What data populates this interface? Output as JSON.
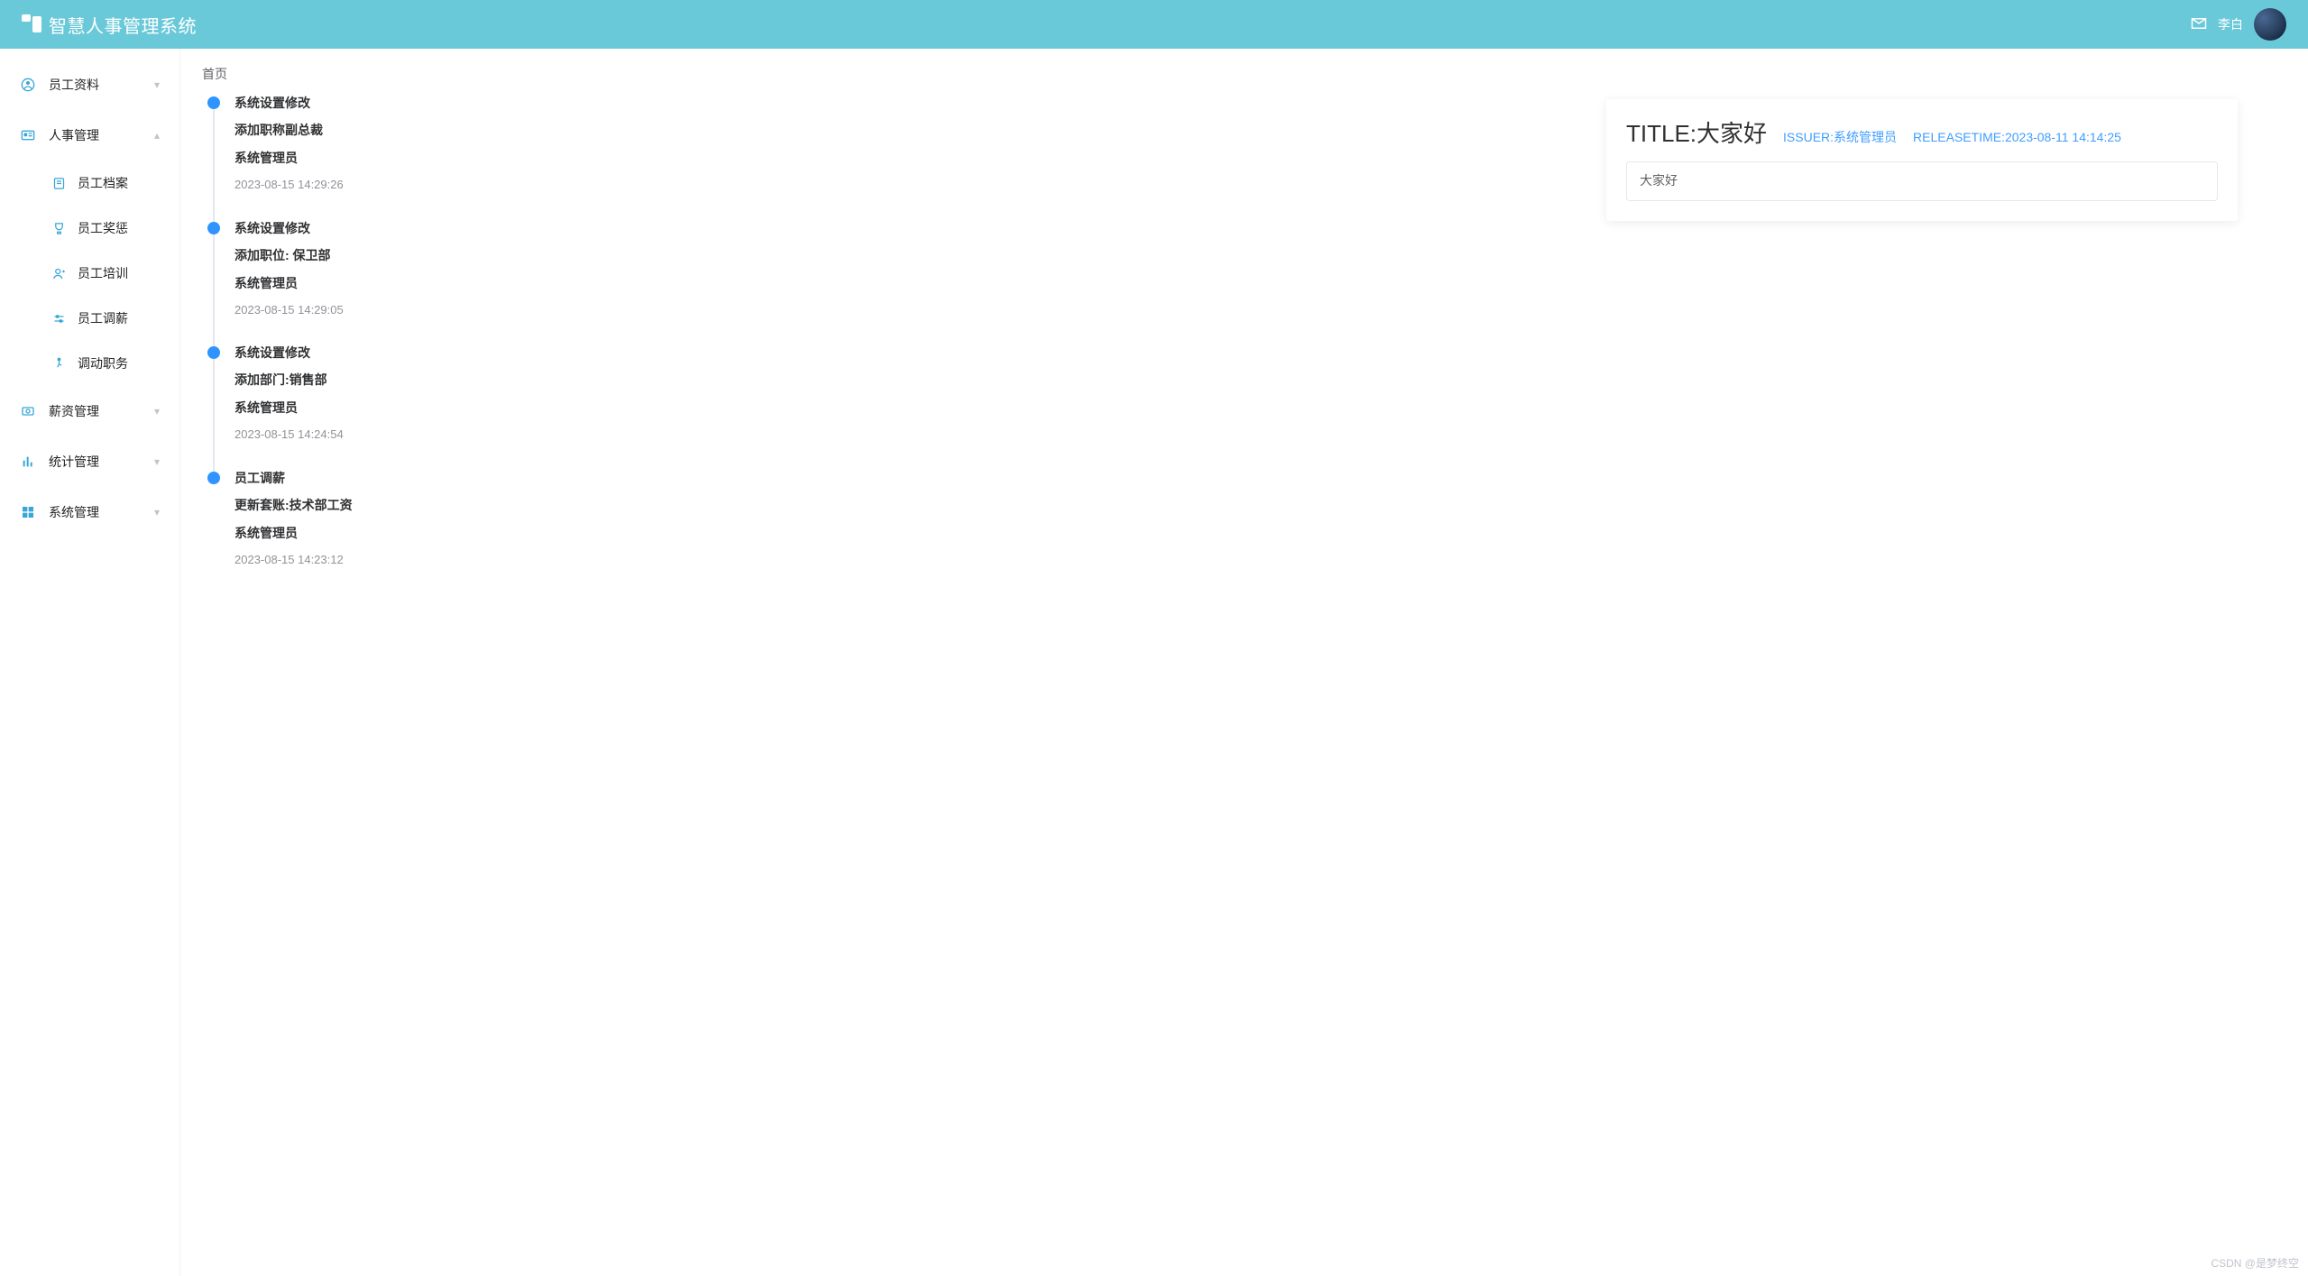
{
  "header": {
    "app_title": "智慧人事管理系统",
    "user_name": "李白"
  },
  "sidebar": {
    "items": [
      {
        "label": "员工资料",
        "expanded": false
      },
      {
        "label": "人事管理",
        "expanded": true,
        "children": [
          {
            "label": "员工档案"
          },
          {
            "label": "员工奖惩"
          },
          {
            "label": "员工培训"
          },
          {
            "label": "员工调薪"
          },
          {
            "label": "调动职务"
          }
        ]
      },
      {
        "label": "薪资管理",
        "expanded": false
      },
      {
        "label": "统计管理",
        "expanded": false
      },
      {
        "label": "系统管理",
        "expanded": false
      }
    ]
  },
  "breadcrumb": "首页",
  "timeline": [
    {
      "title": "系统设置修改",
      "action": "添加职称副总裁",
      "user": "系统管理员",
      "time": "2023-08-15 14:29:26"
    },
    {
      "title": "系统设置修改",
      "action": "添加职位: 保卫部",
      "user": "系统管理员",
      "time": "2023-08-15 14:29:05"
    },
    {
      "title": "系统设置修改",
      "action": "添加部门:销售部",
      "user": "系统管理员",
      "time": "2023-08-15 14:24:54"
    },
    {
      "title": "员工调薪",
      "action": "更新套账:技术部工资",
      "user": "系统管理员",
      "time": "2023-08-15 14:23:12"
    }
  ],
  "card": {
    "title_prefix": "TITLE:",
    "title_value": "大家好",
    "issuer_label": "ISSUER:",
    "issuer_value": "系统管理员",
    "release_label": "RELEASETIME:",
    "release_value": "2023-08-11 14:14:25",
    "content": "大家好"
  },
  "watermark": "CSDN @是梦终空"
}
